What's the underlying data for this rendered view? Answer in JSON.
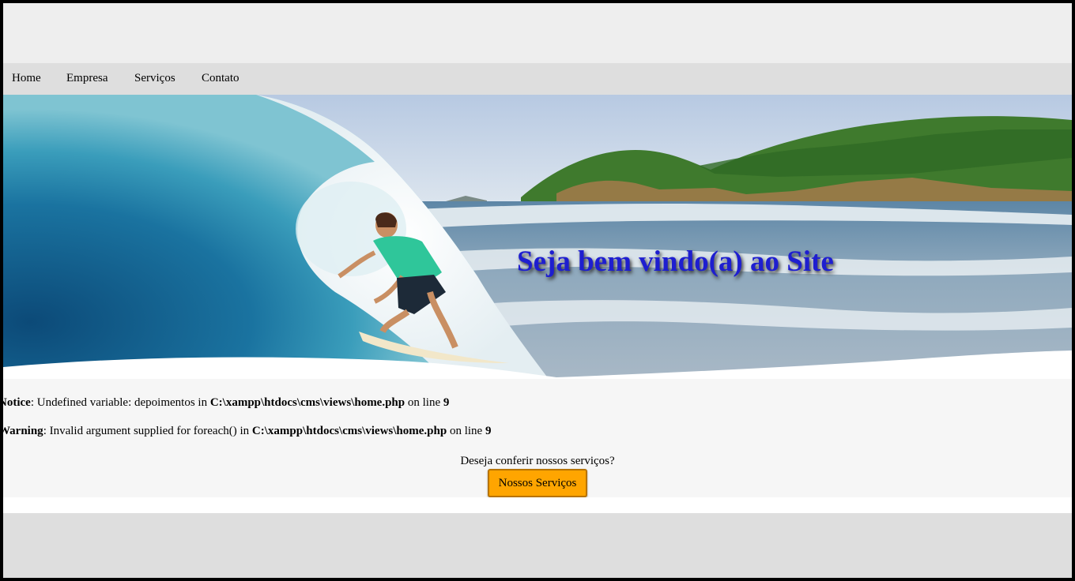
{
  "nav": {
    "items": [
      {
        "label": "Home"
      },
      {
        "label": "Empresa"
      },
      {
        "label": "Serviços"
      },
      {
        "label": "Contato"
      }
    ]
  },
  "banner": {
    "title": "Seja bem vindo(a) ao Site",
    "title_color": "#1e1ed0"
  },
  "messages": [
    {
      "level": "Notice",
      "text": ": Undefined variable: depoimentos in ",
      "file": "C:\\xampp\\htdocs\\cms\\views\\home.php",
      "mid": " on line ",
      "line": "9"
    },
    {
      "level": "Warning",
      "text": ": Invalid argument supplied for foreach() in ",
      "file": "C:\\xampp\\htdocs\\cms\\views\\home.php",
      "mid": " on line ",
      "line": "9"
    }
  ],
  "cta": {
    "question": "Deseja conferir nossos serviços?",
    "button_label": "Nossos Serviços",
    "button_color": "#ffa500"
  }
}
